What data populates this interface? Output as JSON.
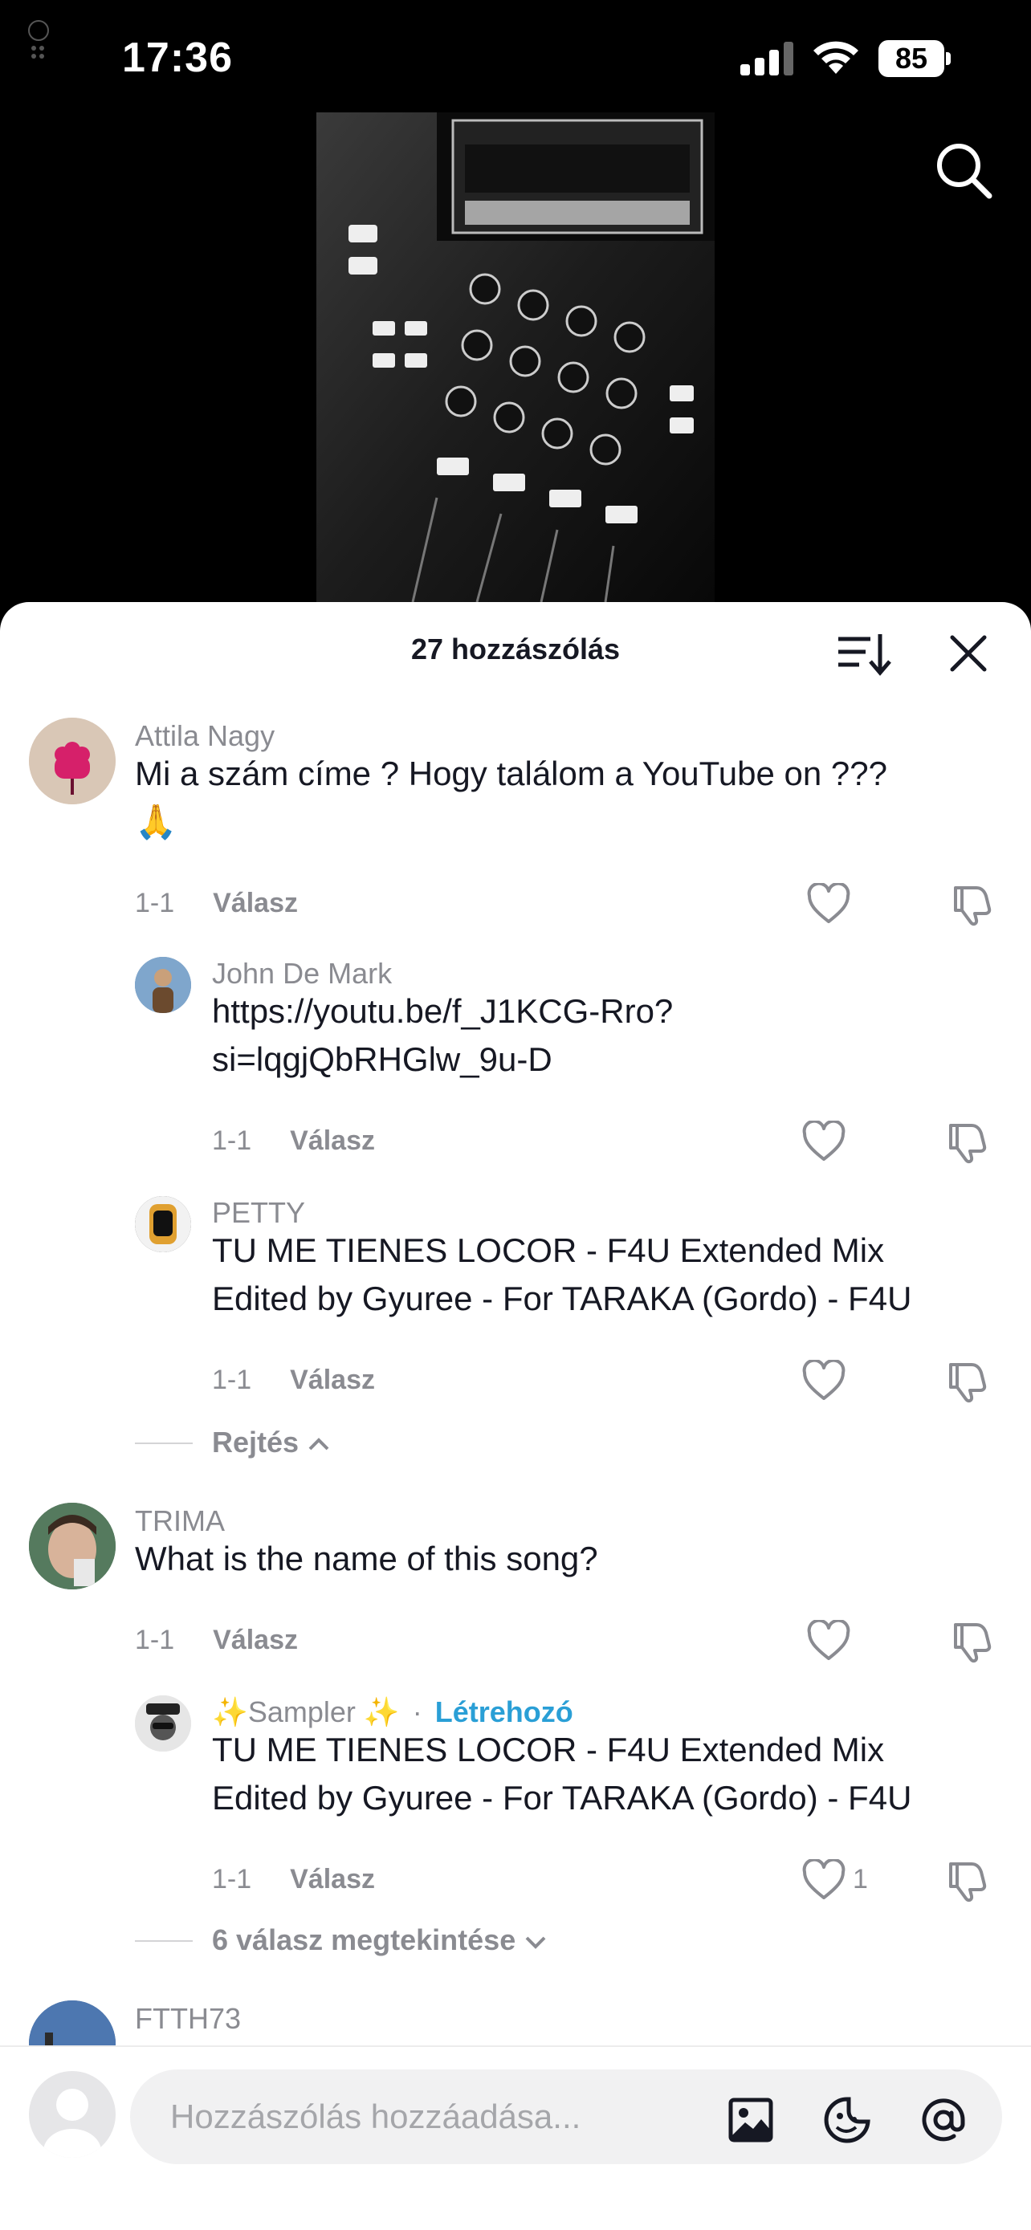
{
  "status_bar": {
    "time": "17:36",
    "battery": "85"
  },
  "sheet": {
    "title": "27 hozzászólás"
  },
  "comments": [
    {
      "user": "Attila Nagy",
      "text_line1": "Mi a szám címe ? Hogy találom a YouTube on ???",
      "text_line2": "🙏",
      "date": "1-1",
      "reply": "Válasz",
      "replies": [
        {
          "user": "John De Mark",
          "text_line1": "https://youtu.be/f_J1KCG-Rro?",
          "text_line2": "si=lqgjQbRHGlw_9u-D",
          "date": "1-1",
          "reply": "Válasz"
        },
        {
          "user": "PETTY",
          "text_line1": "TU ME TIENES LOCOR - F4U Extended Mix",
          "text_line2": "Edited by Gyuree - For TARAKA (Gordo) - F4U",
          "date": "1-1",
          "reply": "Válasz"
        }
      ],
      "toggle": "Rejtés"
    },
    {
      "user": "TRIMA",
      "text_line1": "What is the name of this song?",
      "date": "1-1",
      "reply": "Válasz",
      "replies": [
        {
          "user": "✨Sampler ✨",
          "badge_sep": "·",
          "badge": "Létrehozó",
          "text_line1": "TU ME TIENES LOCOR - F4U Extended Mix",
          "text_line2": "Edited by Gyuree - For TARAKA (Gordo) - F4U",
          "date": "1-1",
          "reply": "Válasz",
          "likes": "1"
        }
      ],
      "toggle": "6 válasz megtekintése"
    },
    {
      "user": "FTTH73"
    }
  ],
  "input": {
    "placeholder": "Hozzászólás hozzáadása..."
  },
  "icons": [
    "search-icon",
    "sort-icon",
    "close-icon",
    "heart-icon",
    "dislike-icon",
    "image-icon",
    "emoji-icon",
    "mention-icon"
  ],
  "colors": {
    "creator": "#2a9fd6",
    "muted": "#8a8b91",
    "text": "#161823"
  }
}
